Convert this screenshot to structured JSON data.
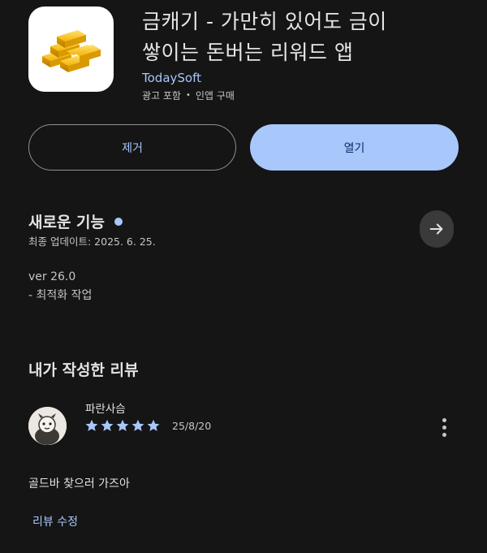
{
  "app": {
    "title_line1": "금캐기 - 가만히 있어도 금이",
    "title_line2": "쌓이는 돈버는 리워드 앱",
    "developer": "TodaySoft",
    "meta_ads": "광고 포함",
    "meta_separator": "•",
    "meta_iap": "인앱 구매",
    "icon": "gold-bars-icon"
  },
  "actions": {
    "remove_label": "제거",
    "open_label": "열기"
  },
  "whats_new": {
    "title": "새로운 기능",
    "updated": "최종 업데이트: 2025. 6. 25.",
    "version": "ver 26.0",
    "note": "- 최적화 작업"
  },
  "my_review": {
    "section_title": "내가 작성한 리뷰",
    "reviewer_name": "파란사슴",
    "rating": 5,
    "max_rating": 5,
    "date": "25/8/20",
    "text": "골드바 찾으러 가즈아",
    "edit_label": "리뷰 수정"
  },
  "colors": {
    "background": "#151515",
    "accent": "#a8c7fa",
    "open_button_text": "#062e6f",
    "text_primary": "#e3e3e3",
    "text_secondary": "#c4c7c5"
  }
}
